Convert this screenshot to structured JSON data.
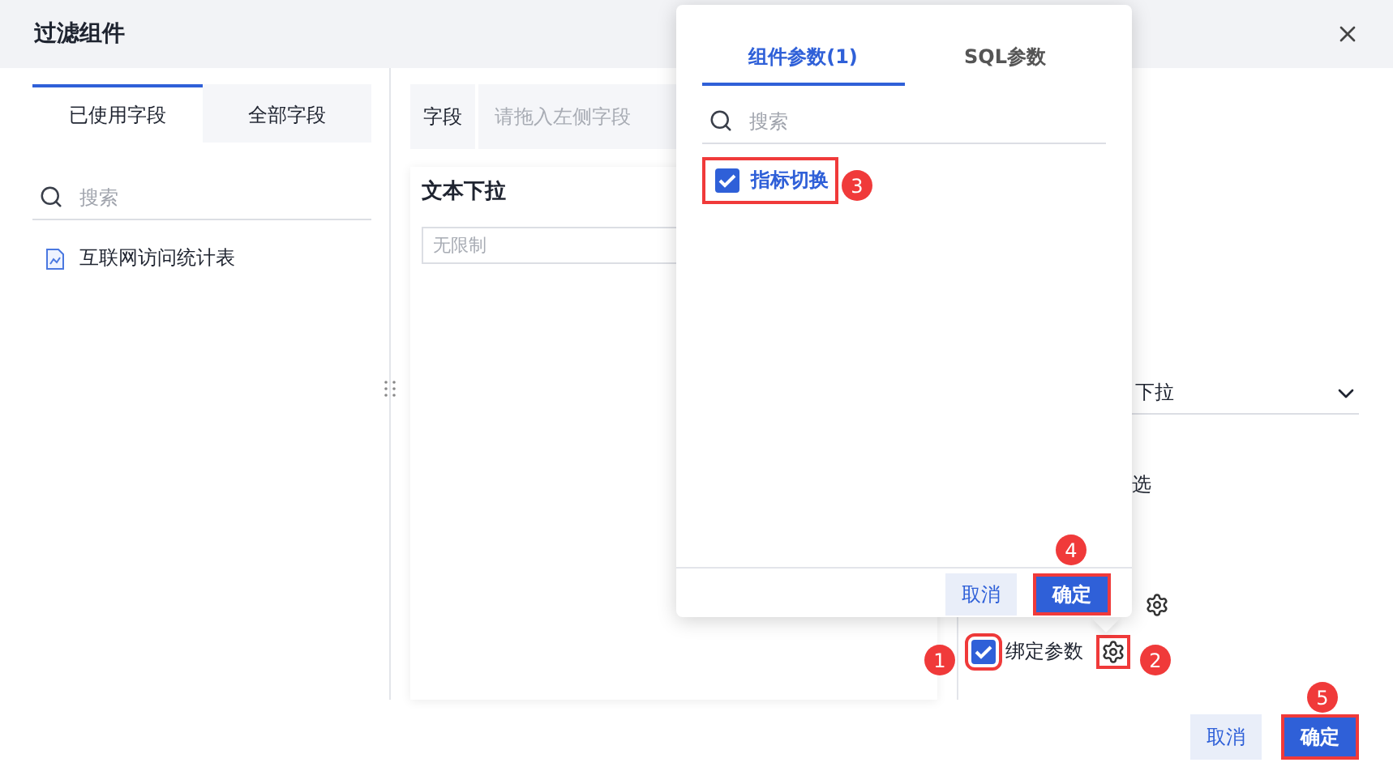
{
  "dialog": {
    "title": "过滤组件"
  },
  "left_panel": {
    "tabs": [
      {
        "label": "已使用字段",
        "selected": true
      },
      {
        "label": "全部字段",
        "selected": false
      }
    ],
    "search": {
      "placeholder": "搜索"
    },
    "items": [
      "互联网访问统计表"
    ]
  },
  "field_bar": {
    "label": "字段",
    "placeholder": "请拖入左侧字段"
  },
  "widget": {
    "title": "文本下拉",
    "select_placeholder": "无限制"
  },
  "settings": {
    "type_value": "下拉",
    "option_fragment": "选",
    "bind_params": {
      "label": "绑定参数",
      "checked": true
    }
  },
  "popup": {
    "tabs": [
      {
        "label": "组件参数(1)",
        "selected": true
      },
      {
        "label": "SQL参数",
        "selected": false
      }
    ],
    "search": {
      "placeholder": "搜索"
    },
    "params": [
      {
        "label": "指标切换",
        "checked": true
      }
    ],
    "cancel": "取消",
    "confirm": "确定"
  },
  "footer": {
    "cancel": "取消",
    "confirm": "确定"
  },
  "annotations": [
    "1",
    "2",
    "3",
    "4",
    "5"
  ]
}
